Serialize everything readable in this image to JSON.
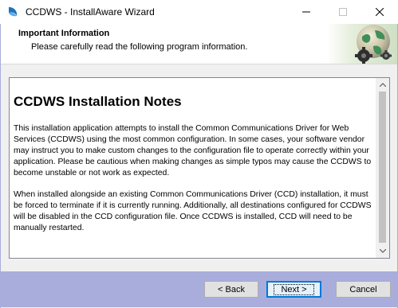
{
  "window": {
    "title": "CCDWS - InstallAware Wizard",
    "controls": [
      "minimize",
      "maximize",
      "close"
    ]
  },
  "header": {
    "title": "Important Information",
    "subtitle": "Please carefully read the following program information."
  },
  "notes": {
    "heading": "CCDWS Installation Notes",
    "paragraph1": "This installation application attempts to install the Common Communications Driver for Web Services (CCDWS) using the most common configuration. In some cases, your software vendor may instruct you to make custom changes to the configuration file to operate correctly within your application. Please be cautious when making changes as simple typos may cause the CCDWS to become unstable or not work as expected.",
    "paragraph2": "When installed alongside an existing Common Communications Driver (CCD) installation, it must be forced to terminate if it is currently running. Additionally, all destinations configured for CCDWS will be disabled in the CCD configuration file. Once CCDWS is installed, CCD will need to be manually restarted."
  },
  "buttons": {
    "back": "< Back",
    "next": "Next >",
    "cancel": "Cancel"
  },
  "colors": {
    "footer": "#a9addc",
    "accent": "#0078d7"
  }
}
